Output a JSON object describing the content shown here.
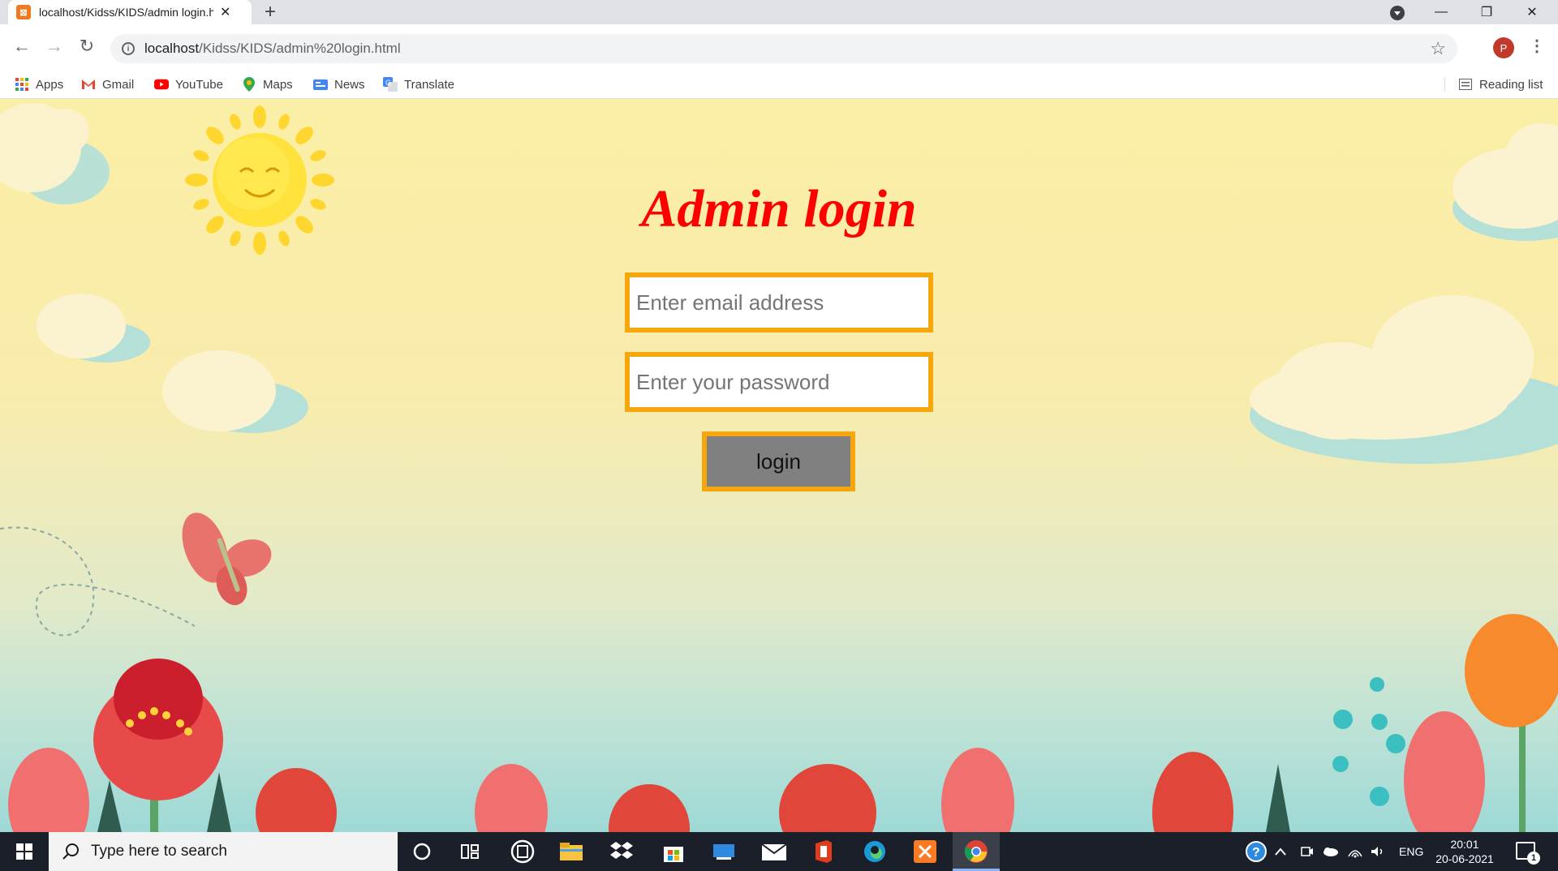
{
  "browser": {
    "tab_title": "localhost/Kidss/KIDS/admin login.html",
    "url_host": "localhost",
    "url_path": "/Kidss/KIDS/admin%20login.html",
    "avatar_letter": "P",
    "bookmarks": [
      "Apps",
      "Gmail",
      "YouTube",
      "Maps",
      "News",
      "Translate"
    ],
    "reading_list": "Reading list"
  },
  "page": {
    "title": "Admin login",
    "email_placeholder": "Enter email address",
    "password_placeholder": "Enter your password",
    "login_label": "login"
  },
  "taskbar": {
    "search_placeholder": "Type here to search",
    "language": "ENG",
    "time": "20:01",
    "date": "20-06-2021",
    "notification_count": "1"
  },
  "colors": {
    "title": "#ff0000",
    "input_border": "#f6a70e",
    "button_bg": "#808080",
    "sky_top": "#fbeea6",
    "sky_bottom": "#9ed9d6"
  }
}
